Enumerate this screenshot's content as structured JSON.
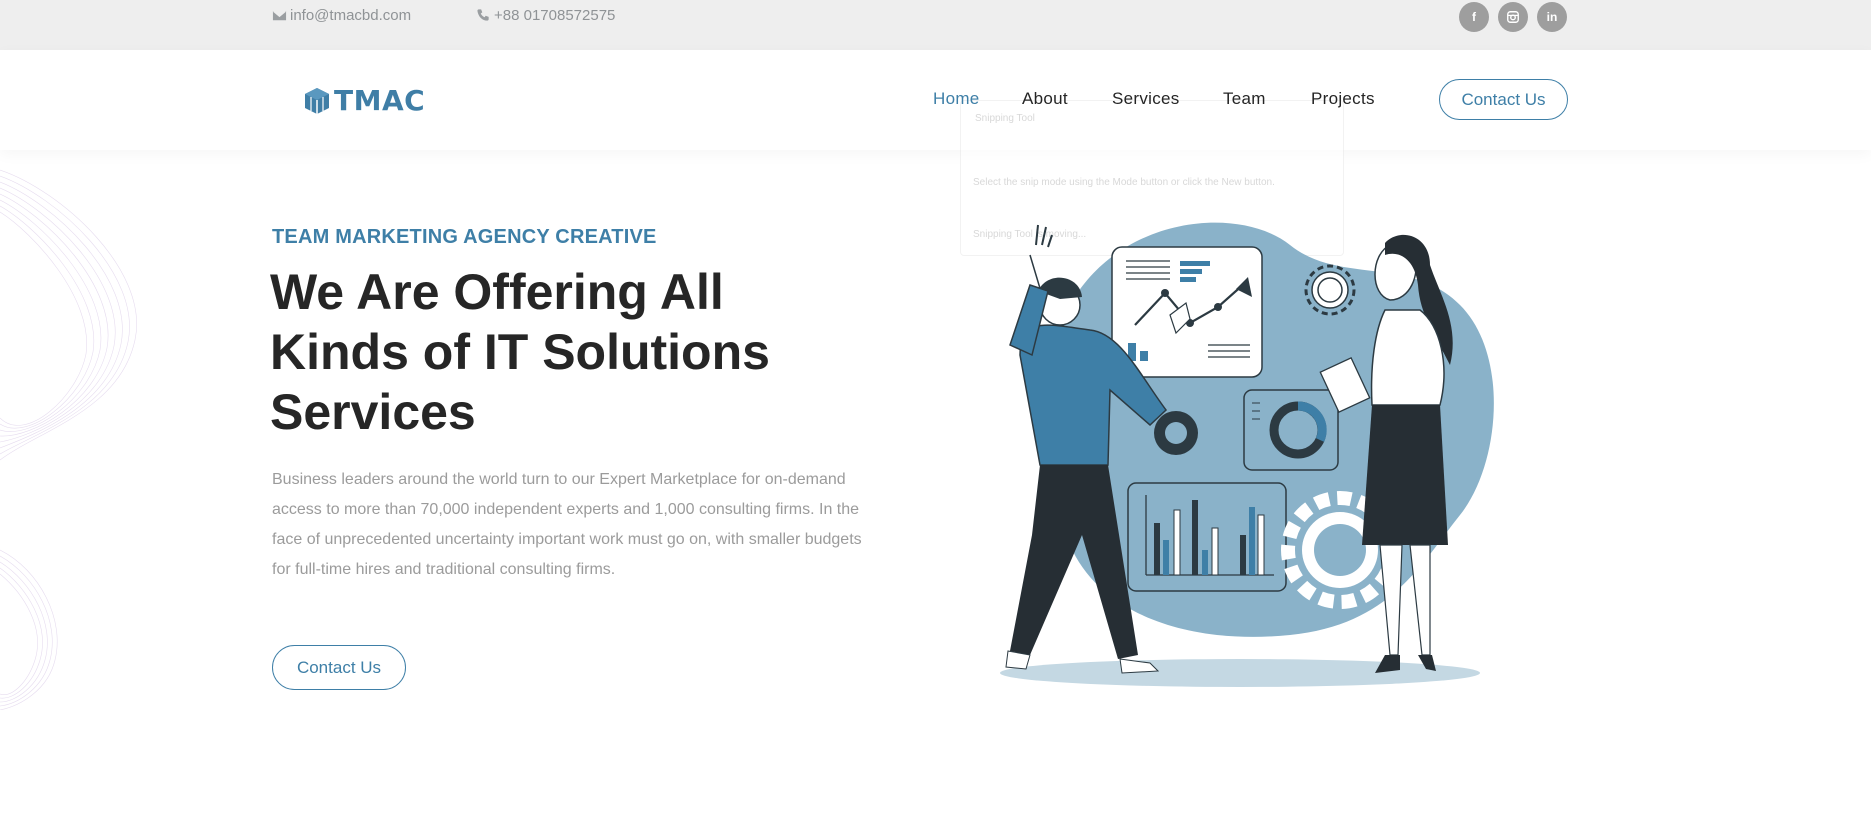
{
  "topbar": {
    "email": "info@tmacbd.com",
    "phone": "+88 01708572575",
    "email_icon": "envelope-icon",
    "phone_icon": "phone-icon",
    "social": [
      {
        "name": "facebook",
        "icon": "facebook-icon",
        "glyph": "f"
      },
      {
        "name": "instagram",
        "icon": "instagram-icon"
      },
      {
        "name": "linkedin",
        "icon": "linkedin-icon",
        "glyph": "in"
      }
    ]
  },
  "header": {
    "logo_text": "TMAC",
    "nav": [
      {
        "label": "Home",
        "active": true
      },
      {
        "label": "About",
        "active": false
      },
      {
        "label": "Services",
        "active": false
      },
      {
        "label": "Team",
        "active": false
      },
      {
        "label": "Projects",
        "active": false
      }
    ],
    "cta_label": "Contact Us"
  },
  "ghost_panel": {
    "title": "Snipping Tool",
    "hint": "Select the snip mode using the Mode button or click the New button.",
    "status": "Snipping Tool is moving..."
  },
  "hero": {
    "eyebrow": "TEAM MARKETING AGENCY CREATIVE",
    "headline": "We Are Offering All Kinds of IT Solutions Services",
    "body": "Business leaders around the world turn to our Expert Marketplace for on-demand access to more than 70,000 independent experts and 1,000 consulting firms. In the face of unprecedented uncertainty important work must go on, with smaller budgets for full-time hires and traditional consulting firms.",
    "cta_label": "Contact Us",
    "illustration": "team-analytics-illustration"
  },
  "colors": {
    "accent": "#3e7fa7",
    "topbar_bg": "#eeeeee",
    "illustration_blob": "#8ab2c9",
    "dark": "#262626"
  }
}
